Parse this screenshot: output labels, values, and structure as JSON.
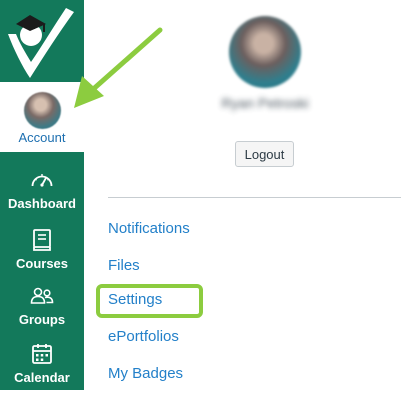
{
  "global_nav": {
    "account_label": "Account",
    "items": [
      {
        "label": "Dashboard",
        "icon": "dashboard-gauge-icon"
      },
      {
        "label": "Courses",
        "icon": "courses-book-icon"
      },
      {
        "label": "Groups",
        "icon": "groups-people-icon"
      },
      {
        "label": "Calendar",
        "icon": "calendar-icon"
      }
    ]
  },
  "account_tray": {
    "profile_name": "Ryan Petroski",
    "logout_label": "Logout",
    "links": [
      "Notifications",
      "Files",
      "Settings",
      "ePortfolios",
      "My Badges"
    ]
  },
  "colors": {
    "nav_background": "#13795b",
    "link": "#2380c9",
    "highlight": "#8ccc3f"
  }
}
